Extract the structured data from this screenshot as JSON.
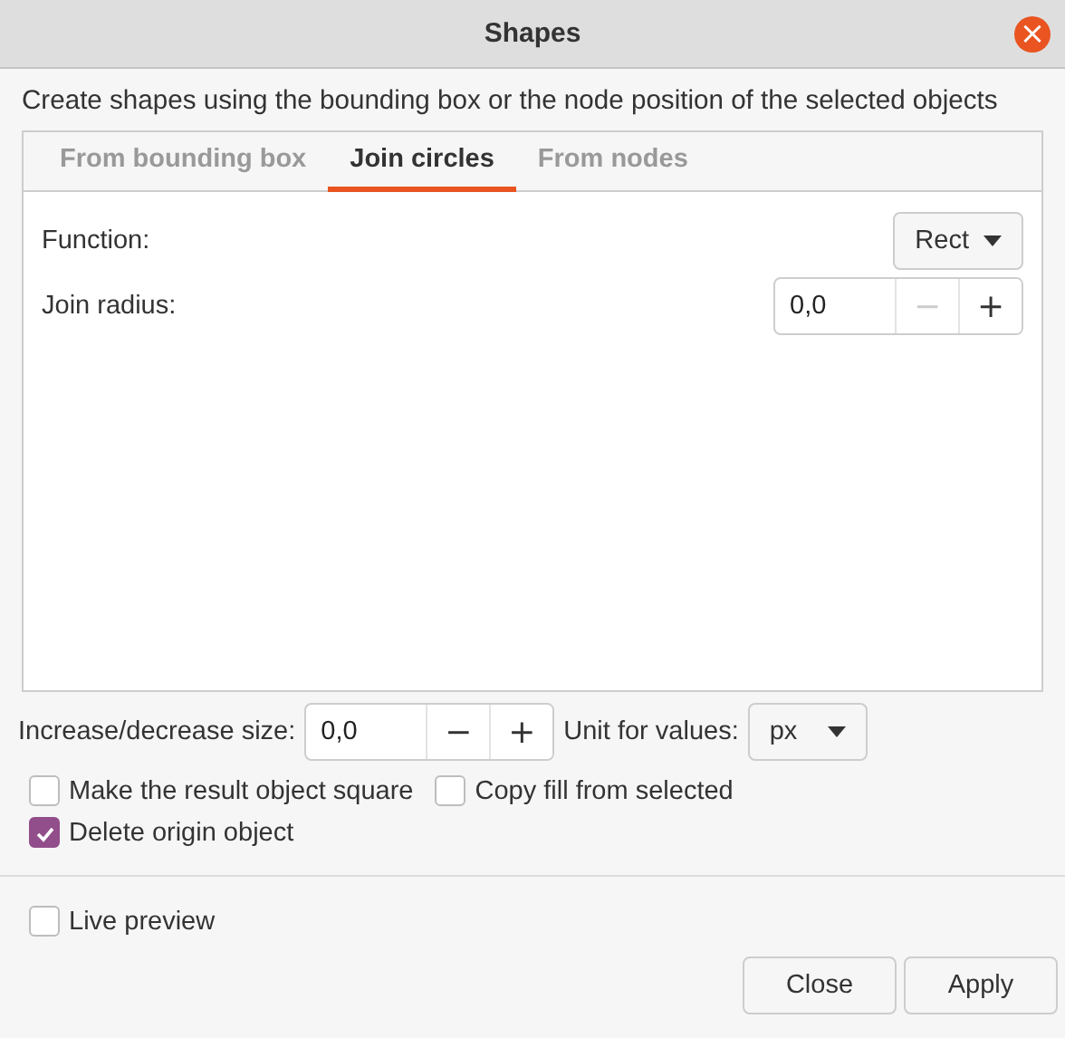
{
  "window": {
    "title": "Shapes",
    "close": "×"
  },
  "description": "Create shapes using the bounding box or the node position of the selected objects",
  "tabs": [
    {
      "label": "From bounding box",
      "selected": false
    },
    {
      "label": "Join circles",
      "selected": true
    },
    {
      "label": "From nodes",
      "selected": false
    }
  ],
  "panel": {
    "function": {
      "label": "Function:",
      "value": "Rect"
    },
    "join_radius": {
      "label": "Join radius:",
      "value": "0,0",
      "steps": [
        {
          "label": "−",
          "disabled": true
        },
        {
          "label": "+",
          "disabled": false
        }
      ]
    }
  },
  "size": {
    "label": "Increase/decrease size:",
    "value": "0,0",
    "steps": [
      {
        "label": "−",
        "disabled": false
      },
      {
        "label": "+",
        "disabled": false
      }
    ]
  },
  "unit": {
    "label": "Unit for values:",
    "value": "px"
  },
  "options": [
    {
      "label": "Make the result object square",
      "checked": false
    },
    {
      "label": "Copy fill from selected",
      "checked": false
    },
    {
      "label": "Delete origin object",
      "checked": true
    }
  ],
  "live_preview": {
    "label": "Live preview",
    "checked": false
  },
  "buttons": [
    "Close",
    "Apply"
  ]
}
